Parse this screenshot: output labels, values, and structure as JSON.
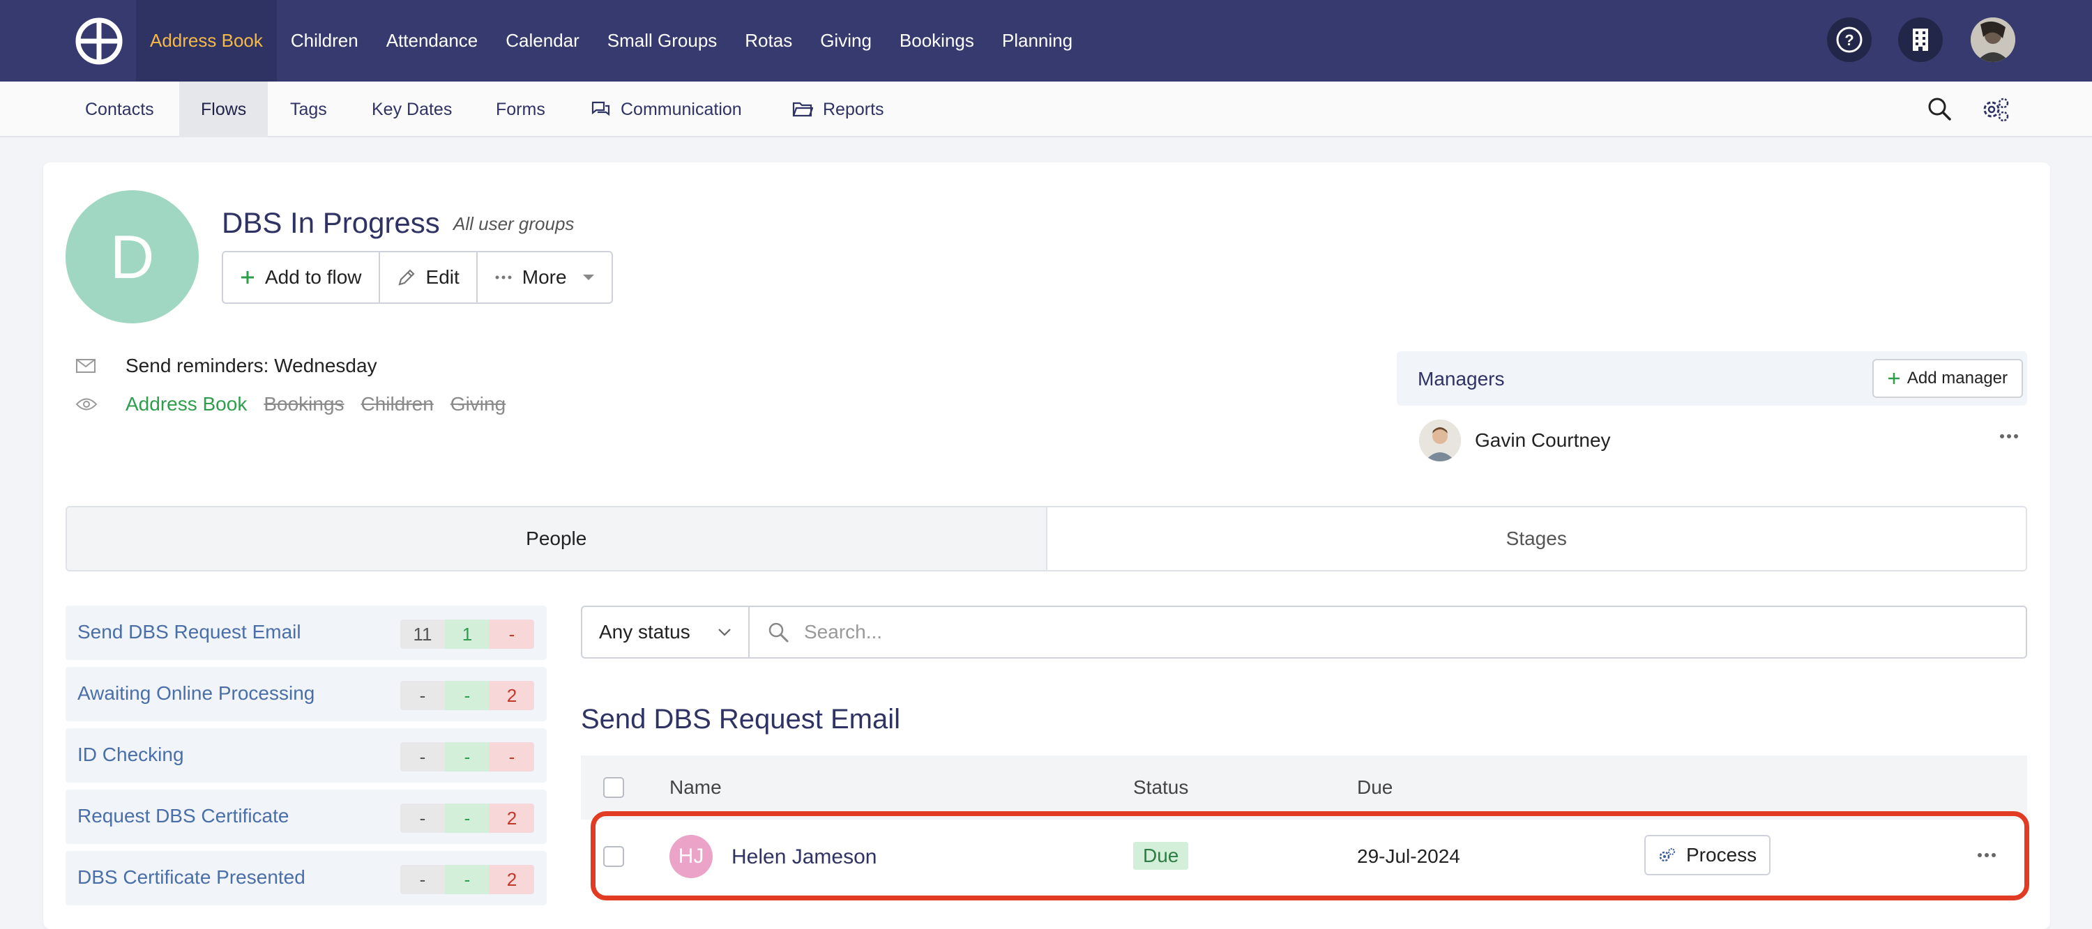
{
  "topnav": {
    "items": [
      {
        "label": "Address Book",
        "active": true
      },
      {
        "label": "Children",
        "active": false
      },
      {
        "label": "Attendance",
        "active": false
      },
      {
        "label": "Calendar",
        "active": false
      },
      {
        "label": "Small Groups",
        "active": false
      },
      {
        "label": "Rotas",
        "active": false
      },
      {
        "label": "Giving",
        "active": false
      },
      {
        "label": "Bookings",
        "active": false
      },
      {
        "label": "Planning",
        "active": false
      }
    ],
    "right_icons": [
      "help-icon",
      "building-icon",
      "user-avatar"
    ]
  },
  "subnav": {
    "items": [
      {
        "label": "Contacts",
        "active": false
      },
      {
        "label": "Flows",
        "active": true
      },
      {
        "label": "Tags",
        "active": false
      },
      {
        "label": "Key Dates",
        "active": false
      },
      {
        "label": "Forms",
        "active": false
      },
      {
        "label": "Communication",
        "active": false,
        "icon": "chat-icon"
      },
      {
        "label": "Reports",
        "active": false,
        "icon": "folder-icon"
      }
    ],
    "right_icons": [
      "search-icon",
      "settings-icon"
    ]
  },
  "flow": {
    "avatar_letter": "D",
    "title": "DBS In Progress",
    "subtitle": "All user groups",
    "buttons": {
      "add": "Add to flow",
      "edit": "Edit",
      "more": "More"
    },
    "reminder": "Send reminders: Wednesday",
    "visibility": [
      {
        "label": "Address Book",
        "enabled": true
      },
      {
        "label": "Bookings",
        "enabled": false
      },
      {
        "label": "Children",
        "enabled": false
      },
      {
        "label": "Giving",
        "enabled": false
      }
    ]
  },
  "managers": {
    "title": "Managers",
    "add_label": "Add manager",
    "list": [
      {
        "name": "Gavin Courtney"
      }
    ]
  },
  "tabs": [
    {
      "label": "People",
      "active": true
    },
    {
      "label": "Stages",
      "active": false
    }
  ],
  "stages": [
    {
      "name": "Send DBS Request Email",
      "counts": [
        "11",
        "1",
        "-"
      ]
    },
    {
      "name": "Awaiting Online Processing",
      "counts": [
        "-",
        "-",
        "2"
      ]
    },
    {
      "name": "ID Checking",
      "counts": [
        "-",
        "-",
        "-"
      ]
    },
    {
      "name": "Request DBS Certificate",
      "counts": [
        "-",
        "-",
        "2"
      ]
    },
    {
      "name": "DBS Certificate Presented",
      "counts": [
        "-",
        "-",
        "2"
      ]
    }
  ],
  "filter": {
    "status": "Any status",
    "search_placeholder": "Search..."
  },
  "list": {
    "title": "Send DBS Request Email",
    "columns": {
      "name": "Name",
      "status": "Status",
      "due": "Due"
    },
    "rows": [
      {
        "initials": "HJ",
        "name": "Helen Jameson",
        "status": "Due",
        "due": "29-Jul-2024",
        "action": "Process"
      }
    ]
  },
  "colors": {
    "topnav_bg": "#363a6e",
    "accent": "#f5b94a",
    "highlight": "#e23b23",
    "enabled_green": "#2e9e4d"
  }
}
